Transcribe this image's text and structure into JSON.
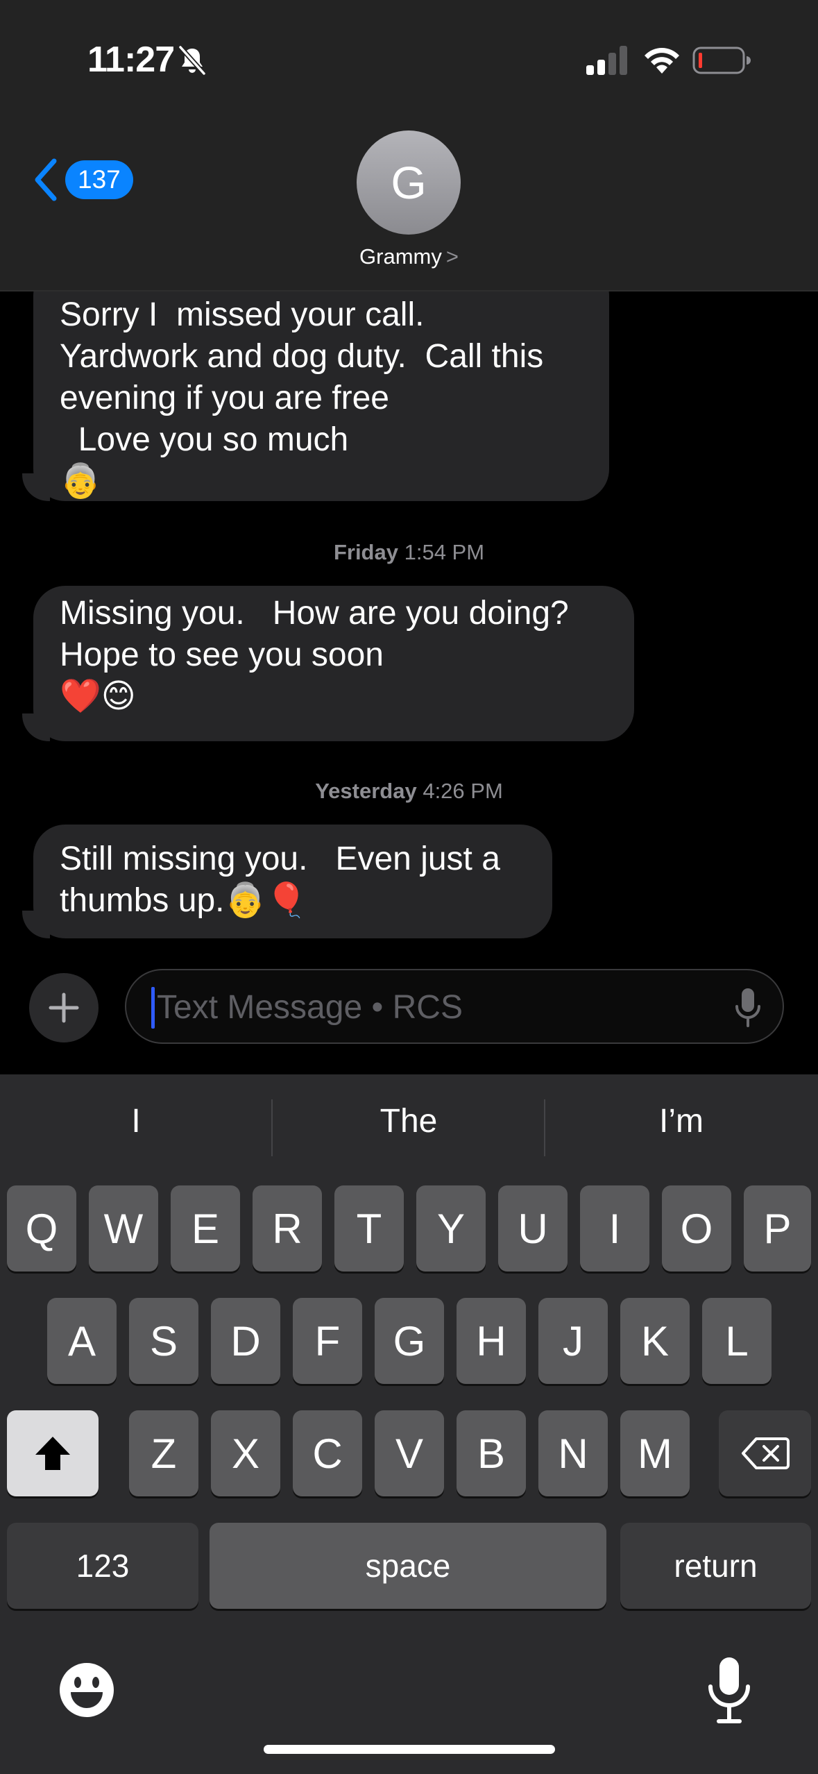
{
  "status_bar": {
    "time": "11:27",
    "icons": [
      "bell-slash-icon",
      "cellular-signal-icon",
      "wifi-icon",
      "battery-low-icon"
    ],
    "battery_color": "#ff3b30"
  },
  "header": {
    "back_count": "137",
    "avatar_initial": "G",
    "contact_name": "Grammy",
    "name_chevron": ">",
    "accent_color": "#0a84ff"
  },
  "messages": [
    {
      "lines": "Sorry I  missed your call.\nYardwork and dog duty.  Call this\nevening if you are free\n  Love you so much\n👵"
    },
    {
      "timestamp_day": "Friday",
      "timestamp_time": "1:54 PM",
      "lines": "Missing you.   How are you doing?\nHope to see you soon\n❤️😊"
    },
    {
      "timestamp_day": "Yesterday",
      "timestamp_time": "4:26 PM",
      "lines": "Still missing you.   Even just a\nthumbs up.👵🎈"
    }
  ],
  "composer": {
    "placeholder": "Text Message • RCS",
    "plus_icon": "plus-icon",
    "mic_icon": "microphone-icon"
  },
  "keyboard": {
    "suggestions": [
      "I",
      "The",
      "I’m"
    ],
    "row1": [
      "Q",
      "W",
      "E",
      "R",
      "T",
      "Y",
      "U",
      "I",
      "O",
      "P"
    ],
    "row2": [
      "A",
      "S",
      "D",
      "F",
      "G",
      "H",
      "J",
      "K",
      "L"
    ],
    "row3": [
      "Z",
      "X",
      "C",
      "V",
      "B",
      "N",
      "M"
    ],
    "numbers_key": "123",
    "space_key": "space",
    "return_key": "return",
    "shift_icon": "shift-icon",
    "delete_icon": "delete-icon",
    "emoji_icon": "emoji-icon",
    "dictation_icon": "microphone-icon"
  }
}
